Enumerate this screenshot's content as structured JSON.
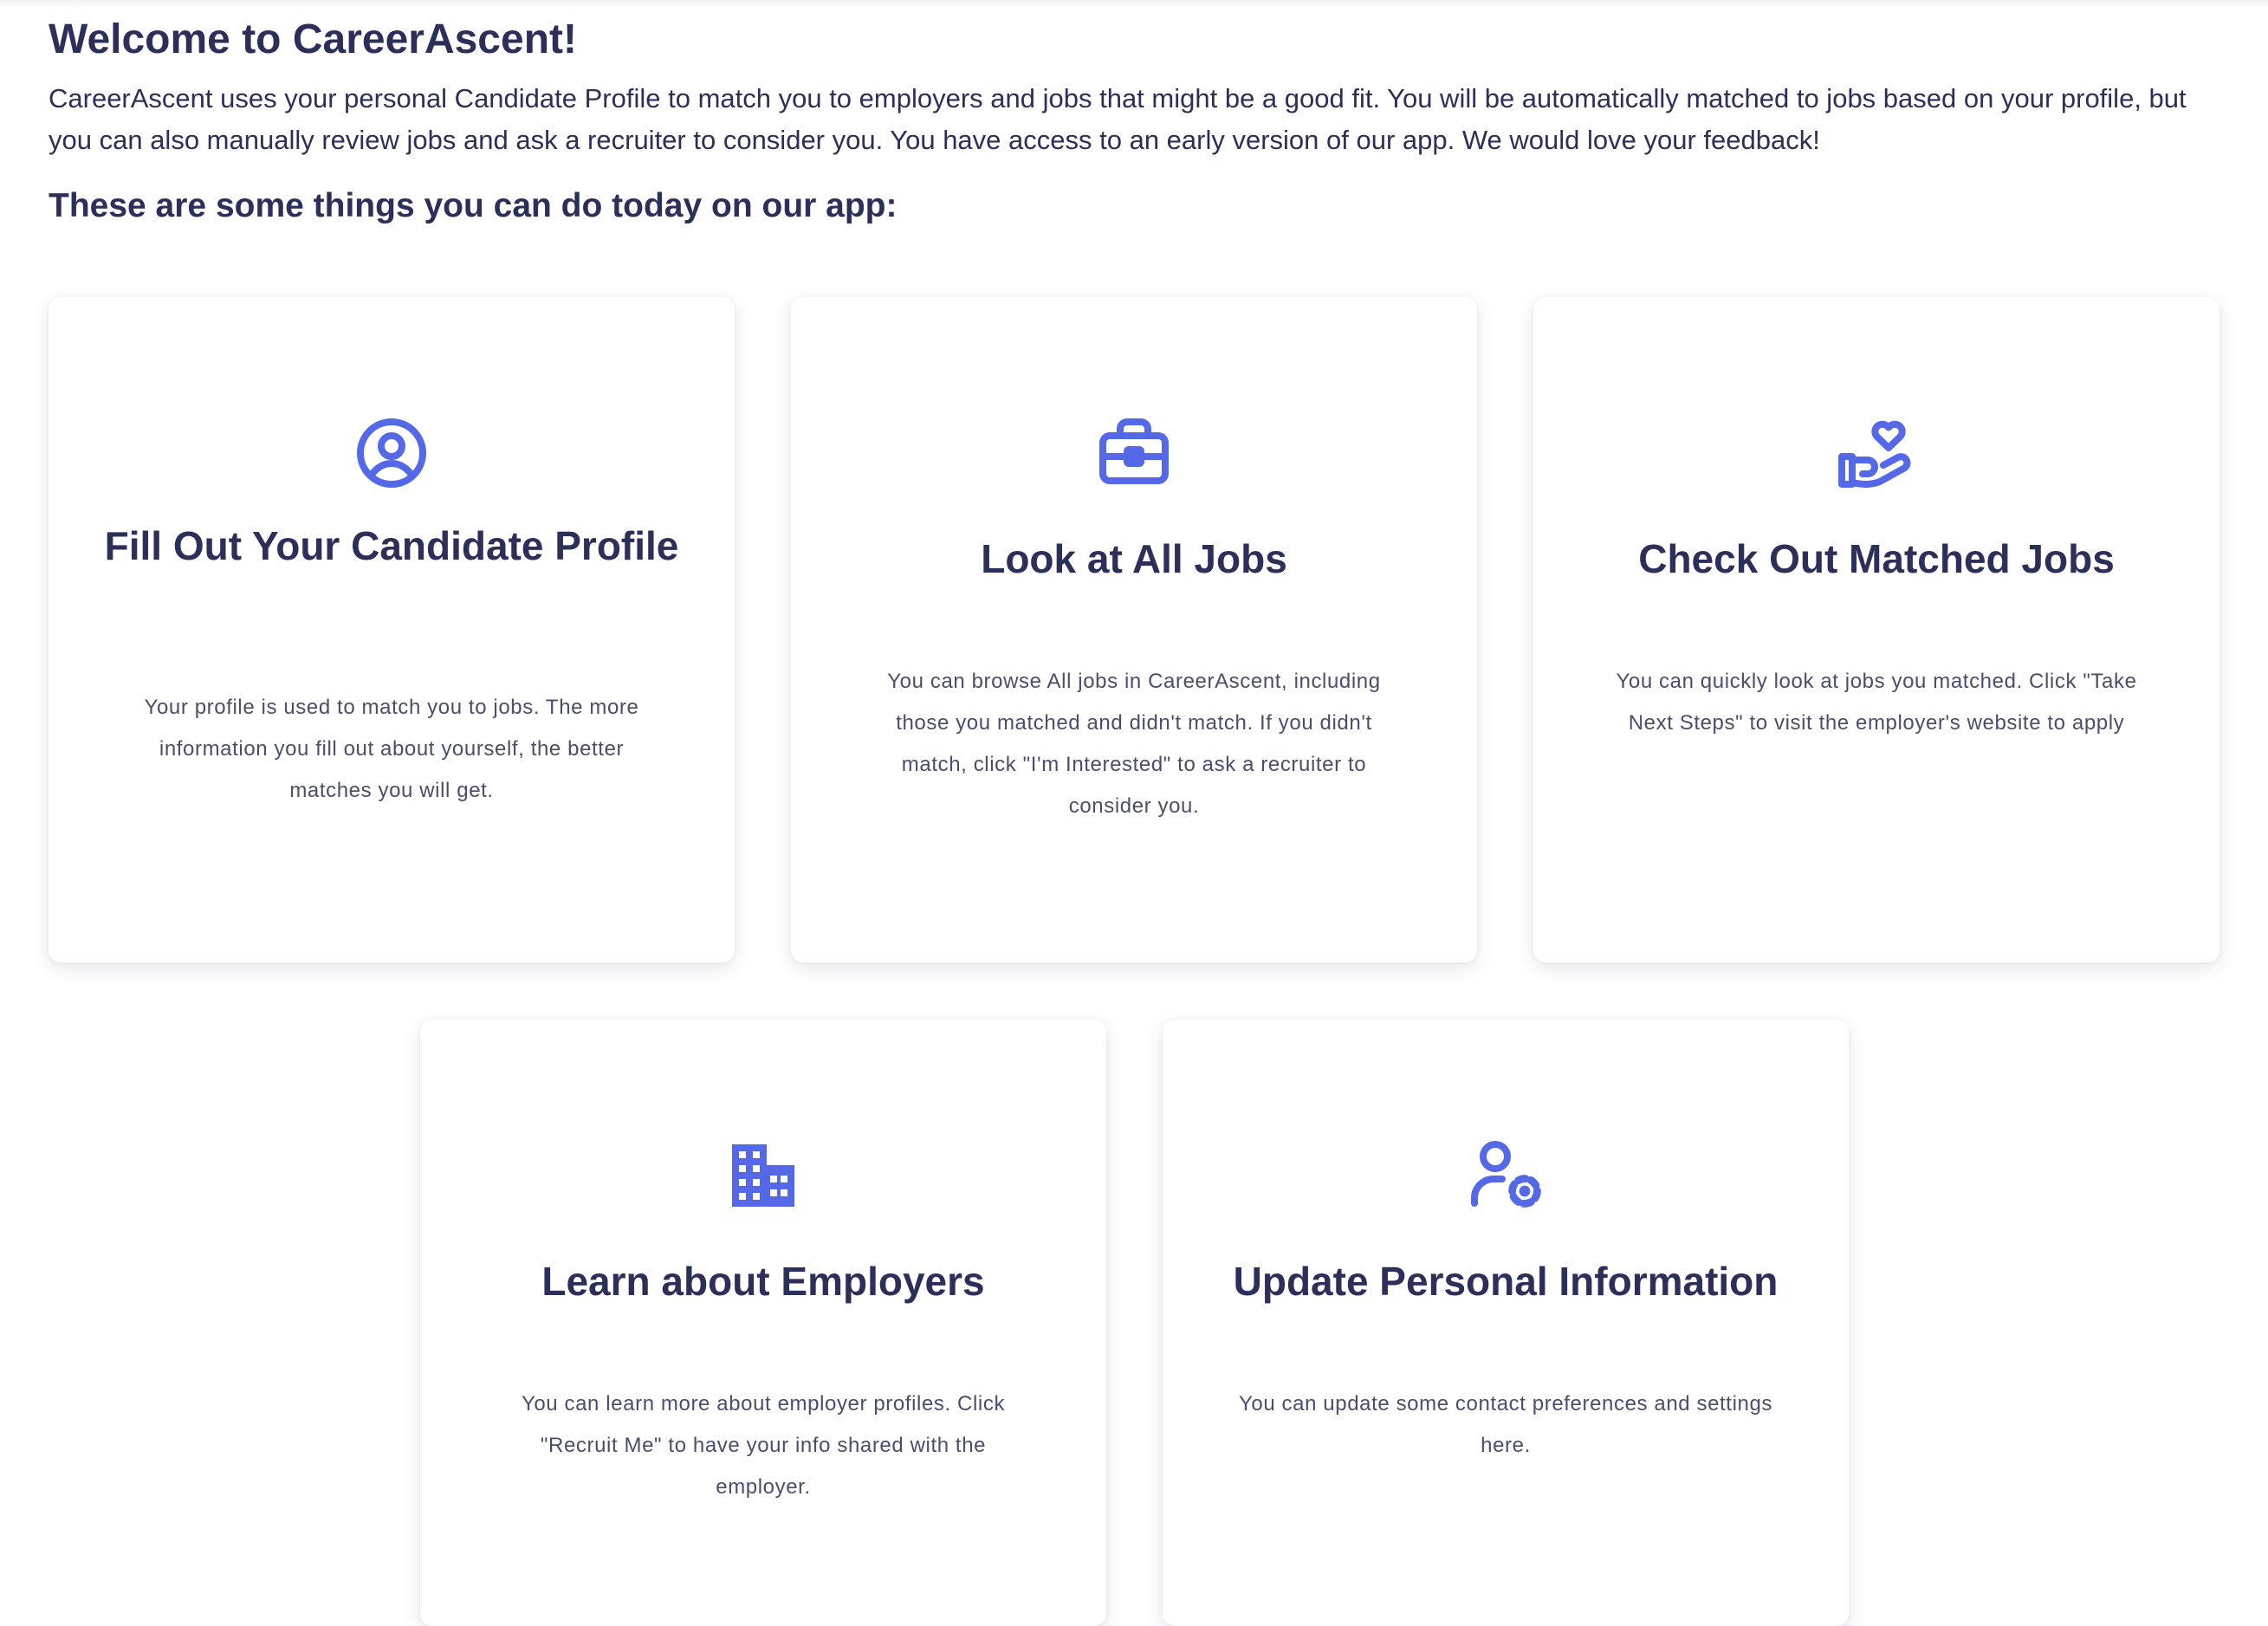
{
  "header": {
    "title": "Welcome to CareerAscent!",
    "intro": "CareerAscent uses your personal Candidate Profile to match you to employers and jobs that might be a good fit. You will be automatically matched to jobs based on your profile, but you can also manually review jobs and ask a recruiter to consider you. You have access to an early version of our app. We would love your feedback!",
    "subheading": "These are some things you can do today on our app:"
  },
  "colors": {
    "accent": "#5468e8",
    "heading": "#2b2f5a",
    "body_text": "#4a4e6e",
    "card_background": "#ffffff"
  },
  "cards": [
    {
      "icon": "user-circle-icon",
      "title": "Fill Out Your Candidate Profile",
      "description": "Your profile is used to match you to jobs. The more information you fill out about yourself, the better matches you will get."
    },
    {
      "icon": "briefcase-icon",
      "title": "Look at All Jobs",
      "description": "You can browse All jobs in CareerAscent, including those you matched and didn't match. If you didn't match, click \"I'm Interested\" to ask a recruiter to consider you."
    },
    {
      "icon": "hand-heart-icon",
      "title": "Check Out Matched Jobs",
      "description": "You can quickly look at jobs you matched. Click \"Take Next Steps\" to visit the employer's website to apply"
    },
    {
      "icon": "building-icon",
      "title": "Learn about Employers",
      "description": "You can learn more about employer profiles. Click \"Recruit Me\" to have your info shared with the employer."
    },
    {
      "icon": "user-settings-icon",
      "title": "Update Personal Information",
      "description": "You can update some contact preferences and settings here."
    }
  ]
}
